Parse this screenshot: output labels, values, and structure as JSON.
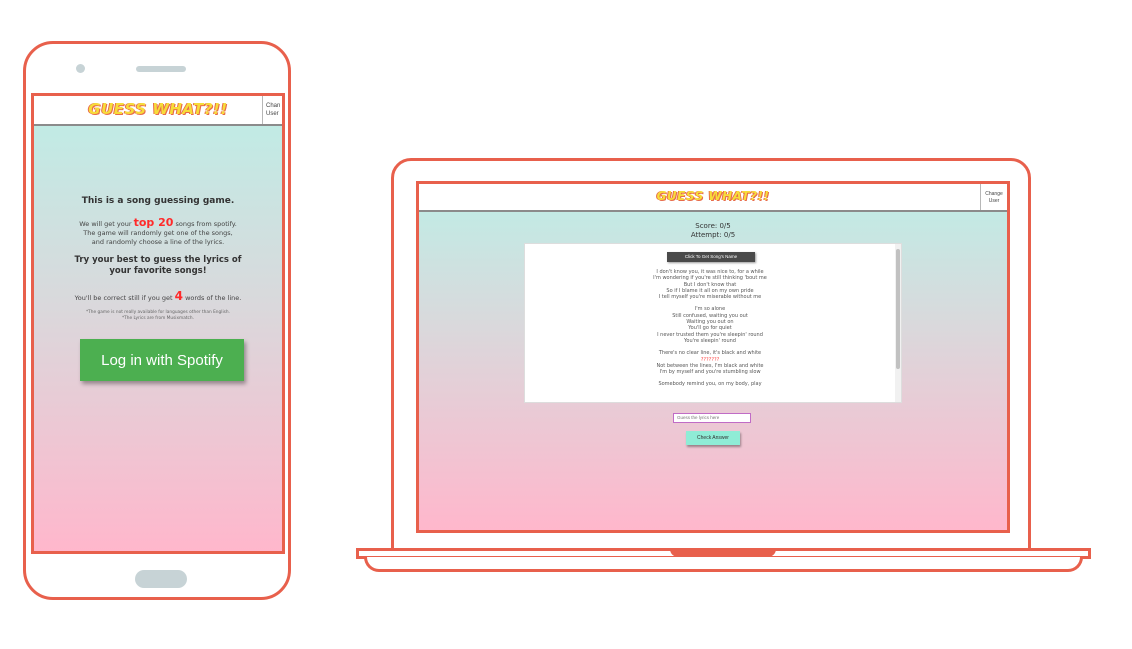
{
  "app": {
    "title": "GUESS WHAT?!!",
    "change_user": "Change User"
  },
  "phone": {
    "change_user": "Chan User",
    "intro": {
      "heading": "This is a song guessing game.",
      "line1_prefix": "We will get your",
      "line1_highlight": "top 20",
      "line1_suffix": "songs from spotify.",
      "line2": "The game will randomly get one of the songs,",
      "line3": "and randomly choose a line of the lyrics.",
      "try": "Try your best to guess the lyrics of your favorite songs!",
      "correct_prefix": "You'll be correct still if you get",
      "correct_number": "4",
      "correct_suffix": "words of the line.",
      "note1": "*The game is not really available for languages other than English.",
      "note2": "*The Lyrics are from Musixmatch."
    },
    "login_button": "Log in with Spotify"
  },
  "laptop": {
    "score": "Score: 0/5",
    "attempt": "Attempt: 0/5",
    "song_name_button": "Click To Get Song's Name",
    "lyrics": [
      "I don't know you, it was nice to, for a while",
      "I'm wondering if you're still thinking 'bout me",
      "But I don't know that",
      "So if I blame it all on my own pride",
      "I tell myself you're miserable without me",
      "",
      "I'm so alone",
      "Still confused, waiting you out",
      "Waiting you out on",
      "You'll go for quiet",
      "I never trusted them you're sleepin' round",
      "You're sleepin' round",
      "",
      "There's no clear line, it's black and white",
      "???????",
      "Not between the lines, I'm black and white",
      "I'm by myself and you're stumbling slow",
      "",
      "Somebody remind you, on my body, play"
    ],
    "hidden_line_index": 14,
    "guess_placeholder": "Guess the lyrics here",
    "check_button": "Check Answer"
  },
  "colors": {
    "device_outline": "#e8604c",
    "gradient_top": "#bdeee6",
    "gradient_bottom": "#ffb7cc",
    "highlight": "#ff2a2a",
    "login_button": "#4caf50",
    "check_button": "#8fecd6",
    "title_yellow": "#f7dc3a"
  }
}
